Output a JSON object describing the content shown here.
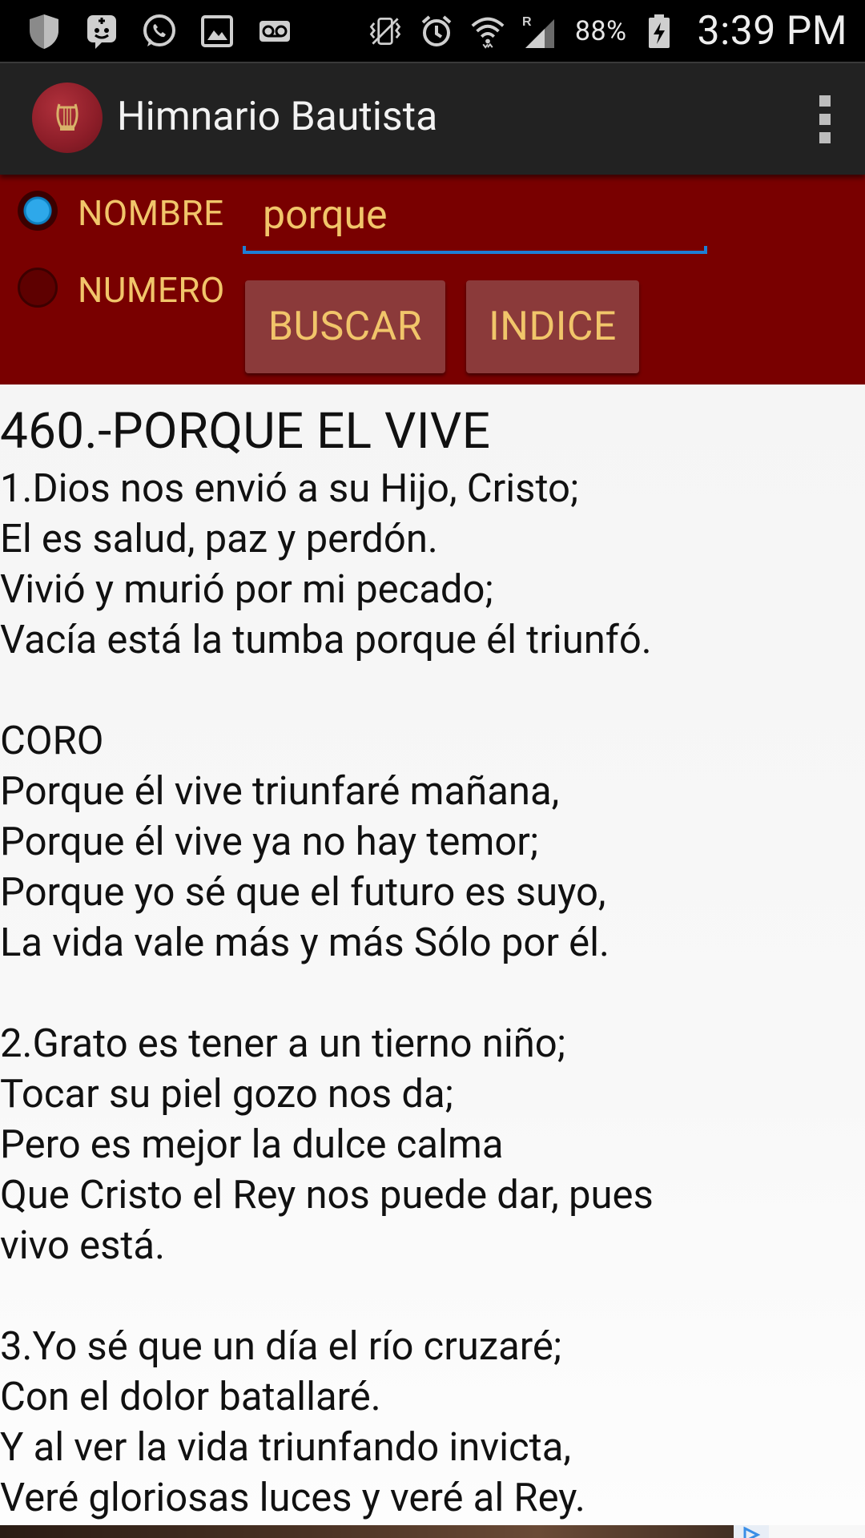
{
  "status_bar": {
    "battery_pct": "88%",
    "time": "3:39 PM",
    "left_icons": [
      "shield-icon",
      "bbm-icon",
      "whatsapp-icon",
      "image-icon",
      "voicemail-icon"
    ],
    "right_icons": [
      "vibrate-icon",
      "alarm-icon",
      "wifi-icon",
      "signal-roaming-icon",
      "battery-charging-icon"
    ]
  },
  "action_bar": {
    "app_title": "Himnario Bautista",
    "logo": "lyre-logo-icon",
    "menu_icon": "overflow-menu-icon"
  },
  "search": {
    "radio_options": [
      {
        "label": "NOMBRE",
        "checked": true
      },
      {
        "label": "NUMERO",
        "checked": false
      }
    ],
    "query_value": "porque",
    "buttons": {
      "search_label": "BUSCAR",
      "index_label": "INDICE"
    }
  },
  "hymn": {
    "title": "460.-PORQUE EL VIVE",
    "lines": [
      "1.Dios nos envió a su Hijo, Cristo;",
      "El es salud, paz y perdón.",
      "Vivió y murió por mi pecado;",
      "Vacía está la tumba porque él triunfó.",
      "",
      "CORO",
      "Porque él vive triunfaré mañana,",
      "Porque él vive ya no hay temor;",
      "Porque yo sé que el futuro es suyo,",
      "La vida vale más y más Sólo por él.",
      "",
      "2.Grato es tener a un tierno niño;",
      "Tocar su piel gozo nos da;",
      "Pero es mejor la dulce calma",
      "Que Cristo el Rey nos puede dar, pues",
      "vivo está.",
      "",
      "3.Yo sé que un día el río cruzaré;",
      "Con el dolor batallaré.",
      "Y al ver la vida triunfando invicta,",
      "Veré gloriosas luces y veré al Rey."
    ]
  },
  "colors": {
    "search_panel_bg": "#790000",
    "accent_text": "#f1c56a",
    "button_bg": "#8b3a3a",
    "input_underline": "#1e7fd6",
    "action_bar_bg": "#222222",
    "content_bg": "#f7f7f7"
  }
}
